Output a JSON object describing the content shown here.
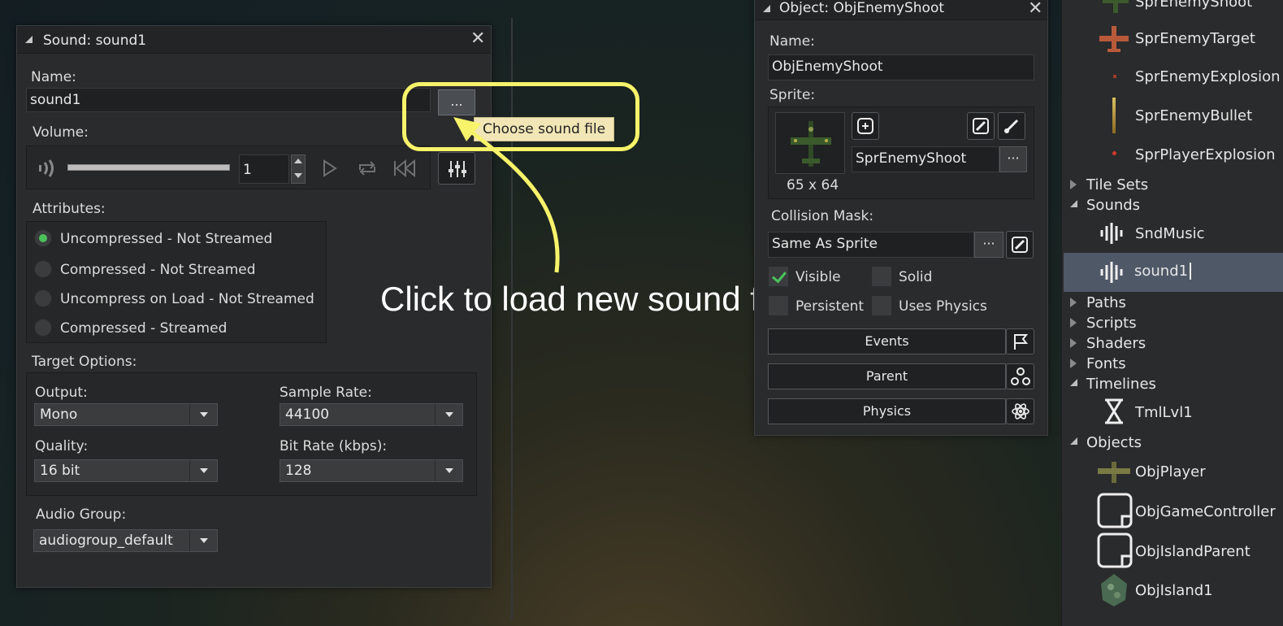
{
  "sound_panel": {
    "title": "Sound: sound1",
    "name_label": "Name:",
    "name_value": "sound1",
    "browse_label": "...",
    "volume_label": "Volume:",
    "volume_value": "1",
    "attributes_label": "Attributes:",
    "attributes": [
      {
        "label": "Uncompressed - Not Streamed",
        "selected": true
      },
      {
        "label": "Compressed - Not Streamed",
        "selected": false
      },
      {
        "label": "Uncompress on Load - Not Streamed",
        "selected": false
      },
      {
        "label": "Compressed - Streamed",
        "selected": false
      }
    ],
    "target_label": "Target Options:",
    "output_label": "Output:",
    "output_value": "Mono",
    "sample_rate_label": "Sample Rate:",
    "sample_rate_value": "44100",
    "quality_label": "Quality:",
    "quality_value": "16 bit",
    "bit_rate_label": "Bit Rate (kbps):",
    "bit_rate_value": "128",
    "audio_group_label": "Audio Group:",
    "audio_group_value": "audiogroup_default"
  },
  "annotation": {
    "tooltip": "Choose sound file",
    "instruction": "Click to load new sound file",
    "color": "#f7f36a"
  },
  "object_panel": {
    "title": "Object: ObjEnemyShoot",
    "name_label": "Name:",
    "name_value": "ObjEnemyShoot",
    "sprite_label": "Sprite:",
    "sprite_name": "SprEnemyShoot",
    "sprite_size": "65 x 64",
    "sprite_browse": "···",
    "collision_label": "Collision Mask:",
    "collision_value": "Same As Sprite",
    "collision_browse": "···",
    "visible_label": "Visible",
    "visible": true,
    "solid_label": "Solid",
    "solid": false,
    "persistent_label": "Persistent",
    "persistent": false,
    "physics_label": "Uses Physics",
    "uses_physics": false,
    "events_button": "Events",
    "parent_button": "Parent",
    "physics_button": "Physics"
  },
  "resource_tree": {
    "sprites": [
      "SprEnemyShoot",
      "SprEnemyTarget",
      "SprEnemyExplosion",
      "SprEnemyBullet",
      "SprPlayerExplosion"
    ],
    "tile_sets": "Tile Sets",
    "sounds": "Sounds",
    "sound_items": [
      "SndMusic",
      "sound1"
    ],
    "paths": "Paths",
    "scripts": "Scripts",
    "shaders": "Shaders",
    "fonts": "Fonts",
    "timelines": "Timelines",
    "timeline_items": [
      "TmlLvl1"
    ],
    "objects": "Objects",
    "object_items": [
      "ObjPlayer",
      "ObjGameController",
      "ObjIslandParent",
      "ObjIsland1"
    ],
    "selected_color": "#4e5866"
  }
}
